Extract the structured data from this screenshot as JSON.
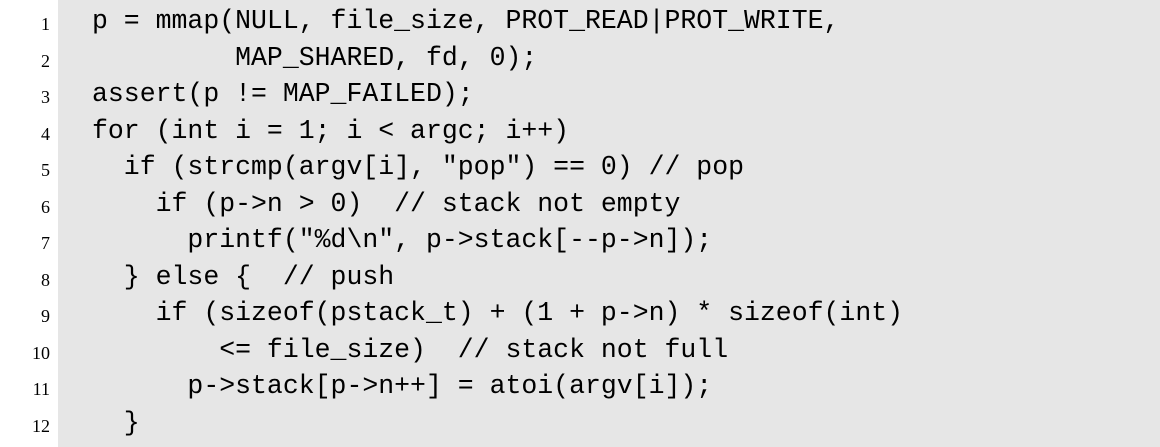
{
  "code_listing": {
    "lines": [
      {
        "number": "1",
        "text": "p = mmap(NULL, file_size, PROT_READ|PROT_WRITE,"
      },
      {
        "number": "2",
        "text": "         MAP_SHARED, fd, 0);"
      },
      {
        "number": "3",
        "text": "assert(p != MAP_FAILED);"
      },
      {
        "number": "4",
        "text": "for (int i = 1; i < argc; i++)"
      },
      {
        "number": "5",
        "text": "  if (strcmp(argv[i], \"pop\") == 0) // pop"
      },
      {
        "number": "6",
        "text": "    if (p->n > 0)  // stack not empty"
      },
      {
        "number": "7",
        "text": "      printf(\"%d\\n\", p->stack[--p->n]);"
      },
      {
        "number": "8",
        "text": "  } else {  // push"
      },
      {
        "number": "9",
        "text": "    if (sizeof(pstack_t) + (1 + p->n) * sizeof(int)"
      },
      {
        "number": "10",
        "text": "        <= file_size)  // stack not full"
      },
      {
        "number": "11",
        "text": "      p->stack[p->n++] = atoi(argv[i]);"
      },
      {
        "number": "12",
        "text": "  }"
      }
    ]
  }
}
